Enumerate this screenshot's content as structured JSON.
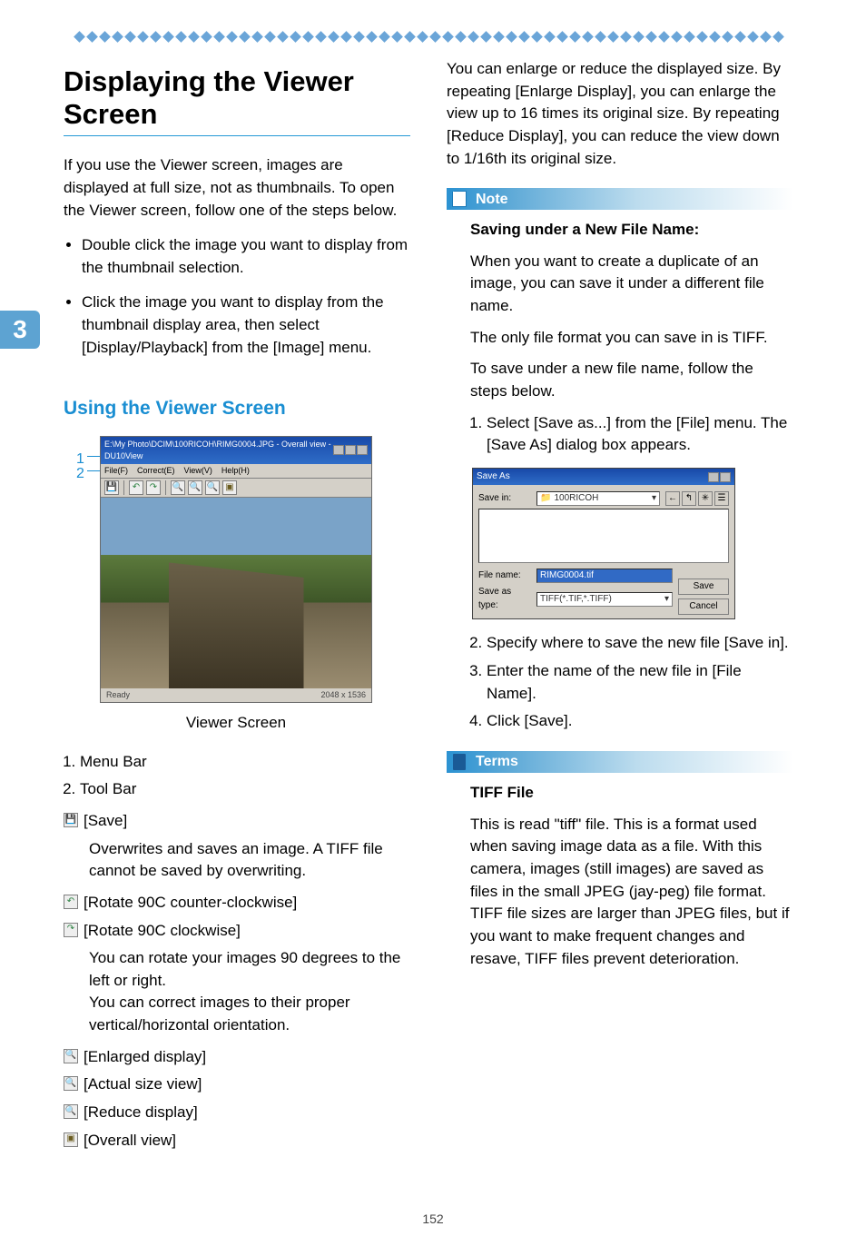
{
  "side_tab": "3",
  "left": {
    "title": "Displaying the Viewer Screen",
    "intro": "If you use the Viewer screen, images are displayed at full size, not as thumbnails. To open the Viewer screen, follow one of the steps below.",
    "bullets": [
      "Double click the image you want to display from the thumbnail selection.",
      "Click the image you want to display from the thumbnail display area, then select [Display/Playback] from the [Image] menu."
    ],
    "subheading": "Using the Viewer Screen",
    "figure": {
      "legend": [
        "1",
        "2"
      ],
      "title": "E:\\My Photo\\DCIM\\100RICOH\\RIMG0004.JPG  -  Overall view - DU10View",
      "menu": [
        "File(F)",
        "Correct(E)",
        "View(V)",
        "Help(H)"
      ],
      "status_left": "Ready",
      "status_right": "2048 x 1536",
      "caption": "Viewer Screen"
    },
    "numbered": [
      "Menu Bar",
      "Tool Bar"
    ],
    "tools": {
      "save": {
        "label": "[Save]",
        "desc": "Overwrites and saves an image. A TIFF file cannot be saved by overwriting."
      },
      "rot_ccw": {
        "label": "[Rotate 90C  counter-clockwise]"
      },
      "rot_cw": {
        "label": "[Rotate 90C  clockwise]",
        "desc": "You can rotate your images 90 degrees to the left or right.\nYou can correct images to their proper vertical/horizontal orientation."
      },
      "enlarge": {
        "label": "[Enlarged display]"
      },
      "actual": {
        "label": "[Actual size view]"
      },
      "reduce": {
        "label": "[Reduce display]"
      },
      "overall": {
        "label": "[Overall view]"
      }
    }
  },
  "right": {
    "zoom_desc": "You can enlarge or reduce the displayed size. By repeating [Enlarge Display], you can enlarge the view up to 16 times its original size. By repeating [Reduce Display], you can reduce the view down to 1/16th its original size.",
    "note": {
      "header": "Note",
      "title": "Saving under a New File Name:",
      "p1": "When you want to create a duplicate of an image, you can save it under a different file name.",
      "p2": "The only file format you can save in is  TIFF.",
      "p3": "To save under a new file name, follow the steps below.",
      "steps": [
        "Select [Save as...] from the [File] menu. The [Save As] dialog box appears.",
        "Specify where to save the new file  [Save in].",
        "Enter the name of the new file in [File Name].",
        "Click [Save]."
      ],
      "dialog": {
        "title": "Save As",
        "save_in_label": "Save in:",
        "save_in_value": "100RICOH",
        "file_name_label": "File name:",
        "file_name_value": "RIMG0004.tif",
        "save_as_type_label": "Save as type:",
        "save_as_type_value": "TIFF(*.TIF,*.TIFF)",
        "save_btn": "Save",
        "cancel_btn": "Cancel"
      }
    },
    "terms": {
      "header": "Terms",
      "title": "TIFF File",
      "body": "This is read \"tiff\" file. This is a format used when saving image data as a file. With this camera, images (still images) are saved as files in the small JPEG (jay-peg) file format. TIFF file sizes are larger than JPEG files, but if you want to make frequent changes and resave, TIFF files prevent deterioration."
    }
  },
  "page_number": "152"
}
